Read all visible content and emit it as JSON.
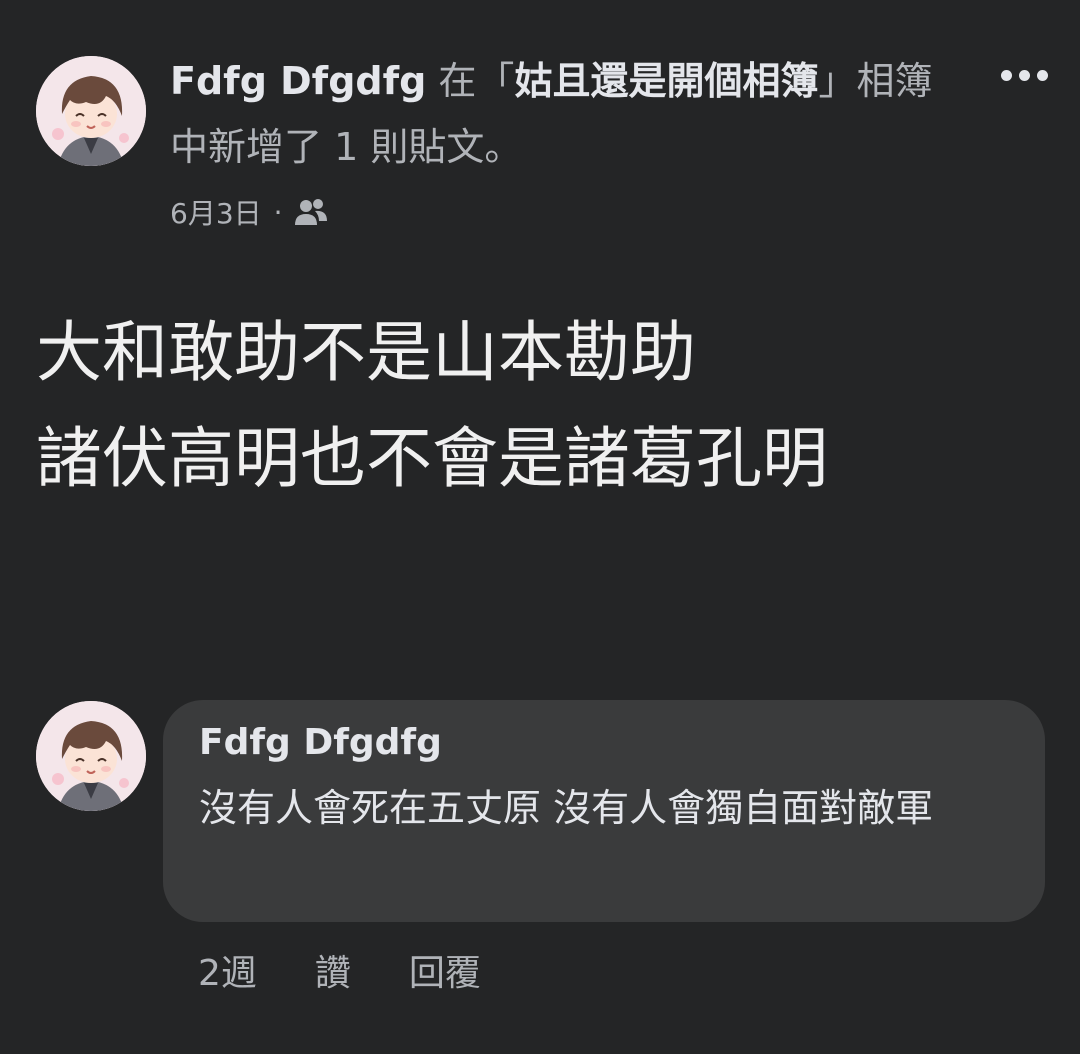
{
  "post": {
    "author": "Fdfg Dfgdfg",
    "action_prefix": " 在「",
    "album_name": "姑且還是開個相簿",
    "action_suffix": "」相簿中新增了 1 則貼文。",
    "date": "6月3日",
    "separator": "·",
    "audience_icon": "friends-icon",
    "body": "大和敢助不是山本勘助\n諸伏高明也不會是諸葛孔明"
  },
  "comment": {
    "author": "Fdfg Dfgdfg",
    "text": "沒有人會死在五丈原 沒有人會獨自面對敵軍",
    "time": "2週",
    "like_label": "讚",
    "reply_label": "回覆"
  },
  "icons": {
    "more": "more-options-icon",
    "avatar": "avatar-anime-character"
  },
  "colors": {
    "background": "#242526",
    "bubble": "#3a3b3c",
    "primary_text": "#e4e6eb",
    "secondary_text": "#b0b3b8"
  }
}
